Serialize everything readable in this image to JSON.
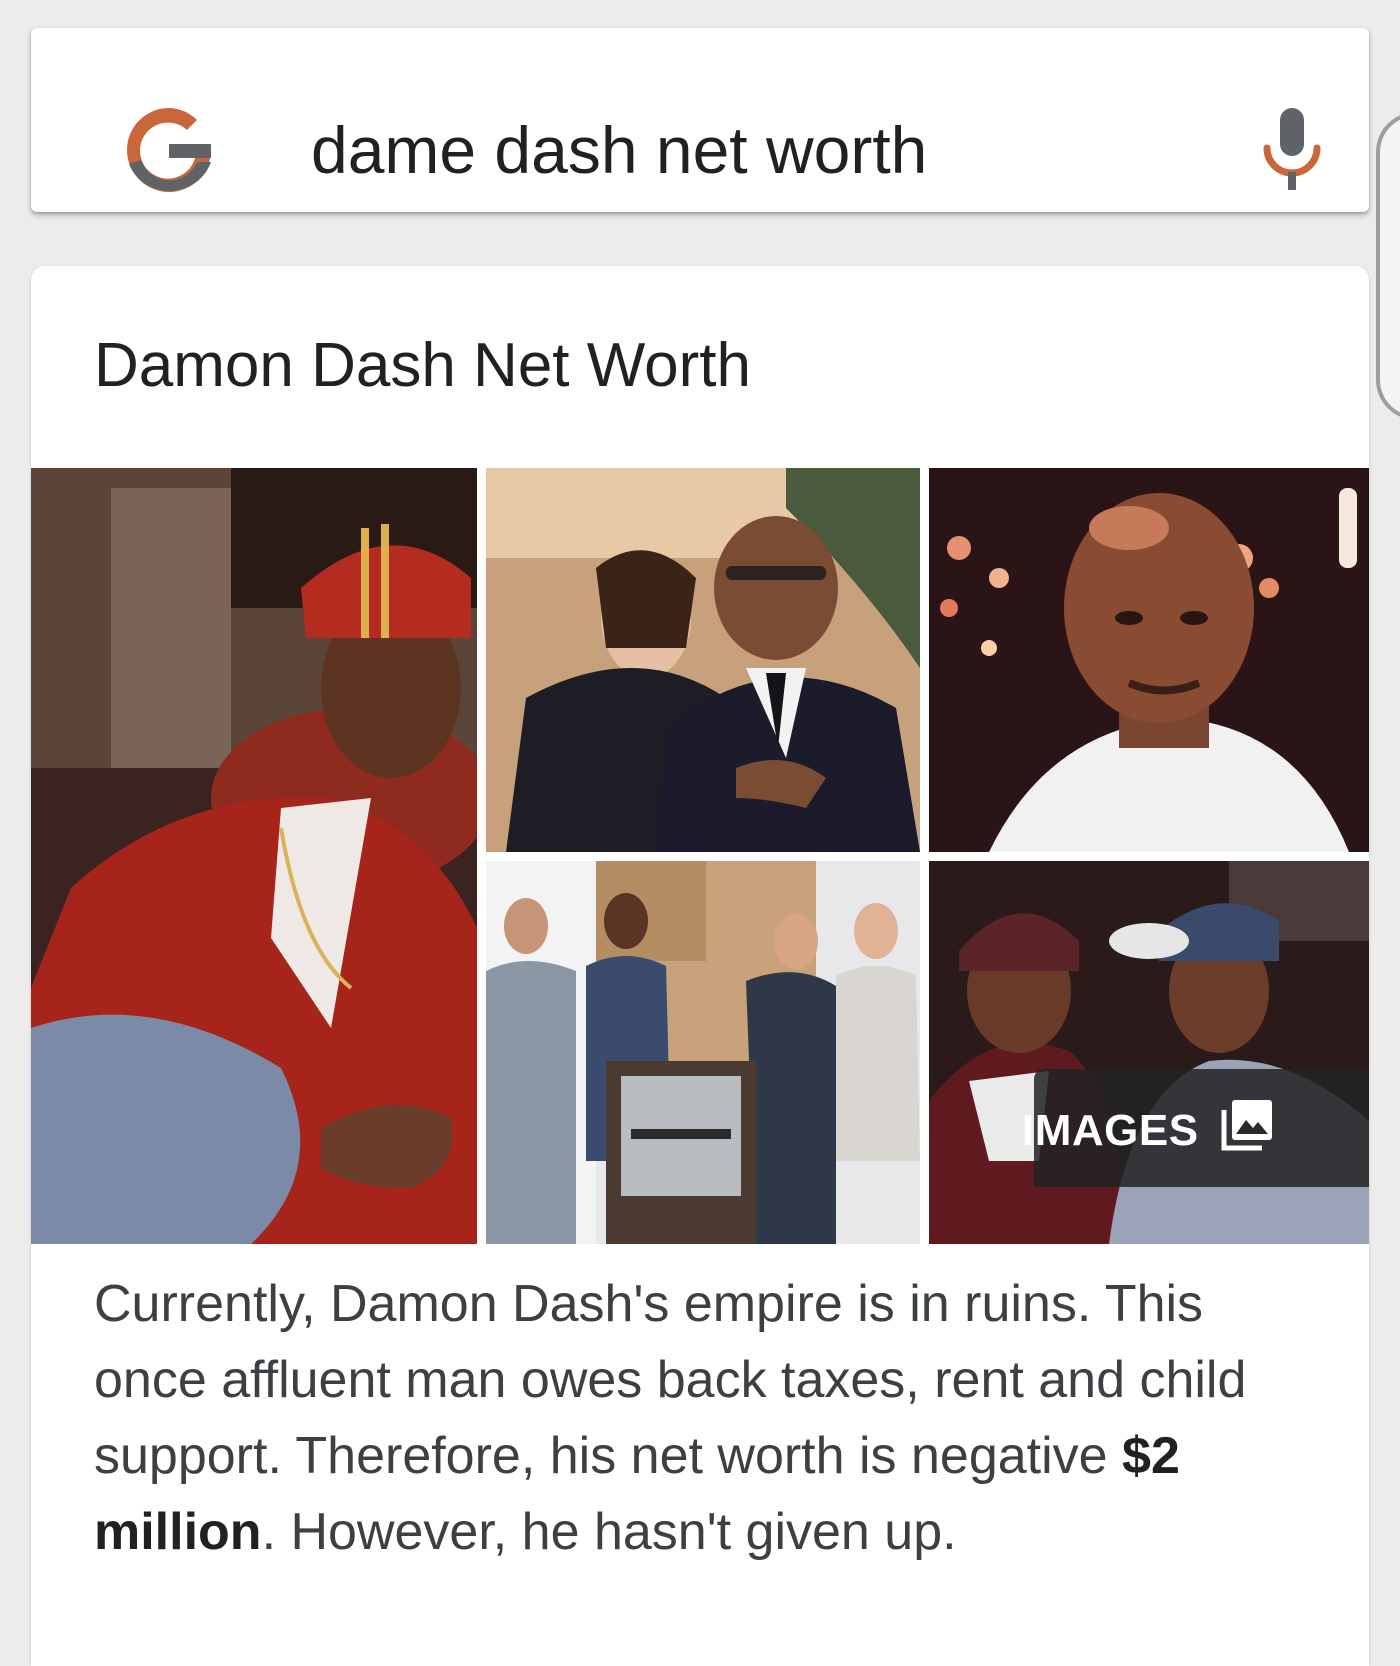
{
  "search": {
    "query": "dame dash net worth",
    "logo_icon": "google-g-icon",
    "mic_icon": "microphone-icon"
  },
  "result": {
    "title": "Damon Dash Net Worth",
    "images_label": "IMAGES",
    "images_icon": "image-gallery-icon",
    "snippet": {
      "part1": "Currently, Damon Dash's empire is in ruins. This once affluent man owes back taxes, rent and child support. Therefore, his net worth is negative ",
      "bold": "$2 million",
      "part2": ". However, he hasn't given up."
    }
  },
  "colors": {
    "background": "#ececec",
    "card": "#ffffff",
    "text": "#202124",
    "google_red": "#c9663a",
    "google_grey": "#5f6368",
    "mic_grey": "#5f6368",
    "mic_orange": "#c9663a"
  }
}
